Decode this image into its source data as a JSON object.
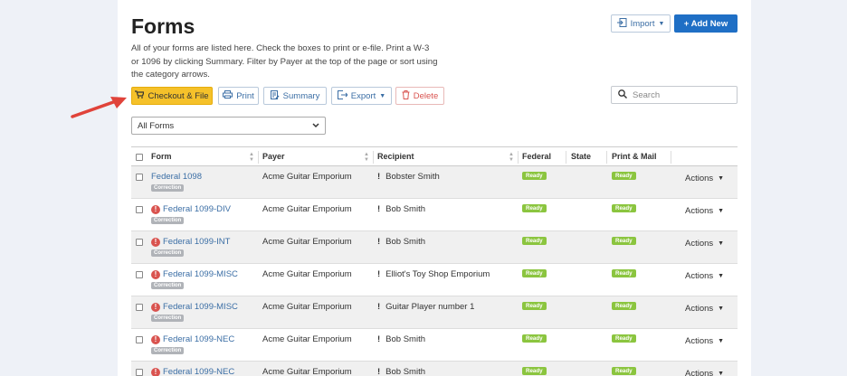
{
  "page": {
    "title": "Forms",
    "description": "All of your forms are listed here. Check the boxes to print or e-file. Print a W-3 or 1096 by clicking Summary. Filter by Payer at the top of the page or sort using the category arrows."
  },
  "header_buttons": {
    "import": "Import",
    "add_new": "+ Add New"
  },
  "toolbar": {
    "checkout": "Checkout & File",
    "print": "Print",
    "summary": "Summary",
    "export": "Export",
    "delete": "Delete"
  },
  "search": {
    "placeholder": "Search"
  },
  "filter": {
    "selected": "All Forms"
  },
  "columns": {
    "form": "Form",
    "payer": "Payer",
    "recipient": "Recipient",
    "federal": "Federal",
    "state": "State",
    "print_mail": "Print & Mail"
  },
  "rows": [
    {
      "form": "Federal 1098",
      "badge": "Correction",
      "payer": "Acme Guitar Emporium",
      "recipient_flag": "!",
      "recipient": "Bobster Smith",
      "federal": "Ready",
      "print_mail": "Ready",
      "actions": "Actions"
    },
    {
      "form": "Federal 1099-DIV",
      "badge": "Correction",
      "payer": "Acme Guitar Emporium",
      "recipient_flag": "!",
      "recipient": "Bob Smith",
      "federal": "Ready",
      "print_mail": "Ready",
      "actions": "Actions"
    },
    {
      "form": "Federal 1099-INT",
      "badge": "Correction",
      "payer": "Acme Guitar Emporium",
      "recipient_flag": "!",
      "recipient": "Bob Smith",
      "federal": "Ready",
      "print_mail": "Ready",
      "actions": "Actions"
    },
    {
      "form": "Federal 1099-MISC",
      "badge": "Correction",
      "payer": "Acme Guitar Emporium",
      "recipient_flag": "!",
      "recipient": "Elliot's Toy Shop Emporium",
      "federal": "Ready",
      "print_mail": "Ready",
      "actions": "Actions"
    },
    {
      "form": "Federal 1099-MISC",
      "badge": "Correction",
      "payer": "Acme Guitar Emporium",
      "recipient_flag": "!",
      "recipient": "Guitar Player number 1",
      "federal": "Ready",
      "print_mail": "Ready",
      "actions": "Actions"
    },
    {
      "form": "Federal 1099-NEC",
      "badge": "Correction",
      "payer": "Acme Guitar Emporium",
      "recipient_flag": "!",
      "recipient": "Bob Smith",
      "federal": "Ready",
      "print_mail": "Ready",
      "actions": "Actions"
    },
    {
      "form": "Federal 1099-NEC",
      "badge": "Correction",
      "payer": "Acme Guitar Emporium",
      "recipient_flag": "!",
      "recipient": "Bob Smith",
      "federal": "Ready",
      "print_mail": "Ready",
      "actions": "Actions"
    }
  ],
  "colors": {
    "primary": "#1f6fc5",
    "checkout": "#f5c12a",
    "ready": "#8bc53f",
    "error": "#d9534f",
    "arrow": "#e0433a"
  }
}
